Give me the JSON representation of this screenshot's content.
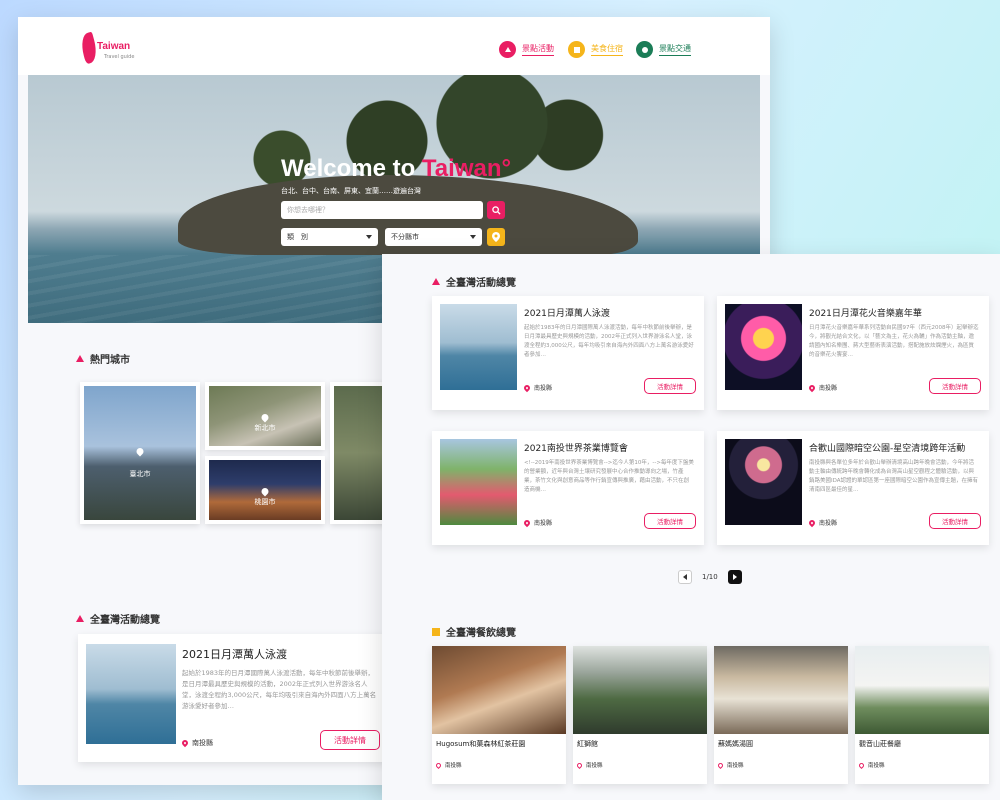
{
  "logo": {
    "word": "Taiwan",
    "sub": "Travel guide"
  },
  "nav": [
    {
      "label": "景點活動",
      "color": "#e91e63"
    },
    {
      "label": "美食住宿",
      "color": "#f5b51b"
    },
    {
      "label": "景點交通",
      "color": "#1b7d57"
    }
  ],
  "hero": {
    "title_pre": "Welcome to ",
    "title_accent": "Taiwan°",
    "subtitle": "台北、台中、台南、屏東、宜蘭……遊遍台灣",
    "search_placeholder": "你想去哪裡？",
    "category_select": "類　別",
    "city_select": "不分縣市"
  },
  "hot_cities": {
    "title": "熱門城市",
    "items": [
      {
        "label": "臺北市"
      },
      {
        "label": "新北市"
      },
      {
        "label": "桃園市"
      }
    ]
  },
  "activities": {
    "title": "全臺灣活動總覽",
    "button_label": "活動詳情",
    "items": [
      {
        "title": "2021日月潭萬人泳渡",
        "desc": "起始於1983年的日月潭國際萬人泳渡活動，每年中秋節前後舉辦，是日月潭最具歷史與規模的活動，2002年正式列入世界游泳名人堂，泳渡全程約3,000公尺，每年均吸引來自海內外四面八方上萬名游泳愛好者參加…",
        "location": "南投縣"
      },
      {
        "title": "2021日月潭花火音樂嘉年華",
        "desc": "日月潭花火音樂嘉年華系列活動自民國97年（西元2008年）起舉辦迄今，將觀光結合文化，以「藝文為主，花火為輔」作為活動主軸，邀請國內知名樂團、蔣大型藝術表演活動，搭配施放炫爛煙火，為區質的音樂花火饗宴…",
        "location": "南投縣"
      },
      {
        "title": "2021南投世界茶業博覽會",
        "desc": "<!--2019年南投世界茶業博覽會-->迄今人第10年，-->每年度下盤美的營業額，近年與台灣土壤研究發展中心合作推動導向之場，竹產業，茶竹文化與創意商品等作行銷宣傳與推廣，藉由活動，不只在創造商機…",
        "location": "南投縣"
      },
      {
        "title": "合歡山國際暗空公園-星空清境跨年活動",
        "desc": "南投縣與各單位多年於合歡山舉辦清境高山跨年晚會活動，今年將活動主軸由傳統跨年晚會轉化成為台灣高山星空觀程之體驗活動，以與銷路美國IDA認證的單認區第一座國際暗空公園作為宣傳主題，在擁有清南四區最佳的星…",
        "location": "南投縣"
      }
    ]
  },
  "pagination": {
    "text": "1/10"
  },
  "restaurants": {
    "title": "全臺灣餐飲總覽",
    "items": [
      {
        "name": "Hugosum和菓森林紅茶莊園",
        "location": "南投縣"
      },
      {
        "name": "紅獅館",
        "location": "南投縣"
      },
      {
        "name": "蘇媽媽湯圓",
        "location": "南投縣"
      },
      {
        "name": "觀音山莊餐廳",
        "location": "南投縣"
      }
    ]
  }
}
